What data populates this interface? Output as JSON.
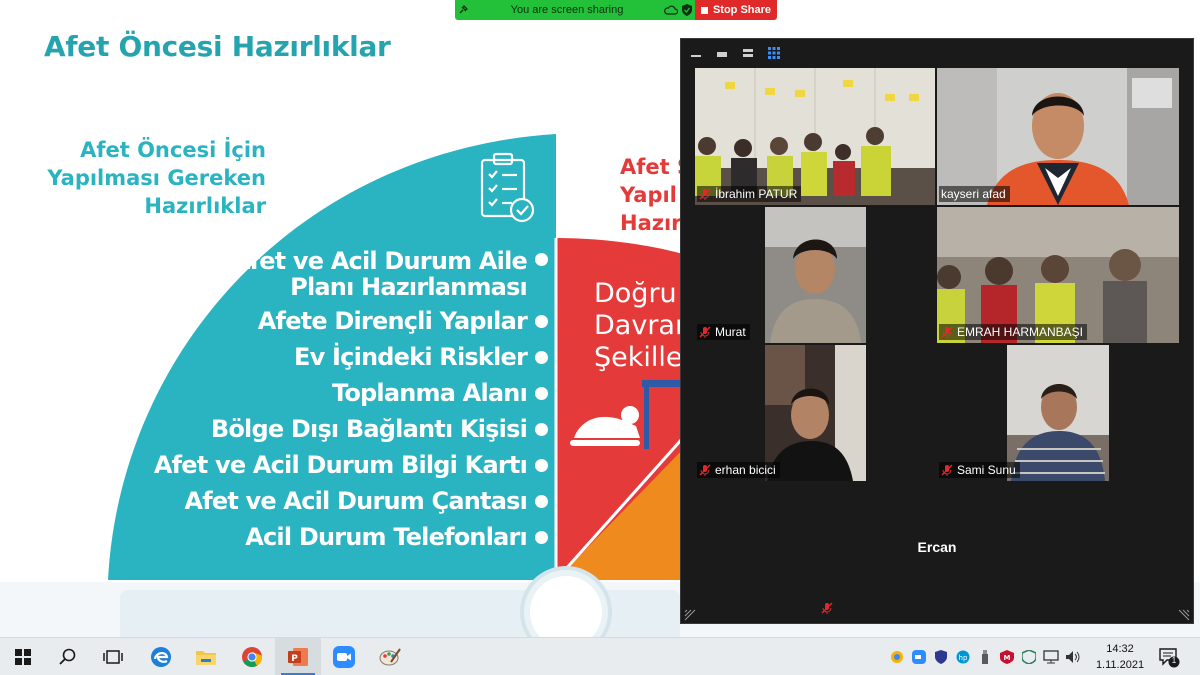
{
  "slide": {
    "title": "Afet Öncesi Hazırlıklar",
    "section_heading": [
      "Afet Öncesi İçin",
      "Yapılması Gereken",
      "Hazırlıklar"
    ],
    "items": [
      [
        "Afet ve Acil Durum Aile",
        "Planı Hazırlanması"
      ],
      [
        "Afete Dirençli Yapılar"
      ],
      [
        "Ev İçindeki Riskler"
      ],
      [
        "Toplanma Alanı"
      ],
      [
        "Bölge Dışı Bağlantı Kişisi"
      ],
      [
        "Afet ve Acil Durum Bilgi Kartı"
      ],
      [
        "Afet ve Acil Durum Çantası"
      ],
      [
        "Acil Durum Telefonları"
      ]
    ],
    "red_heading": [
      "Afet S",
      "Yapıl",
      "Hazır"
    ],
    "red_text": [
      "Doğru",
      "Davran",
      "Şekiller"
    ],
    "colors": {
      "teal": "#2ab3c0",
      "red": "#e53a3a",
      "orange": "#ee8a1e"
    }
  },
  "share_bar": {
    "status": "You are screen sharing",
    "stop_label": "Stop Share"
  },
  "zoom": {
    "participants": [
      {
        "name": "İbrahim PATUR",
        "muted": true,
        "active": false
      },
      {
        "name": "kayseri afad",
        "muted": false,
        "active": true
      },
      {
        "name": "Murat",
        "muted": true,
        "active": false
      },
      {
        "name": "EMRAH HARMANBAŞI",
        "muted": true,
        "active": false
      },
      {
        "name": "erhan bicici",
        "muted": true,
        "active": false
      },
      {
        "name": "Sami Sunu",
        "muted": true,
        "active": false
      },
      {
        "name": "Ercan",
        "muted": true,
        "active": false
      }
    ]
  },
  "taskbar": {
    "apps": [
      "start",
      "search",
      "task-view",
      "edge",
      "file-explorer",
      "chrome",
      "powerpoint",
      "zoom",
      "paint"
    ],
    "active_app": "powerpoint",
    "time": "14:32",
    "date": "1.11.2021",
    "notification_count": "1"
  }
}
